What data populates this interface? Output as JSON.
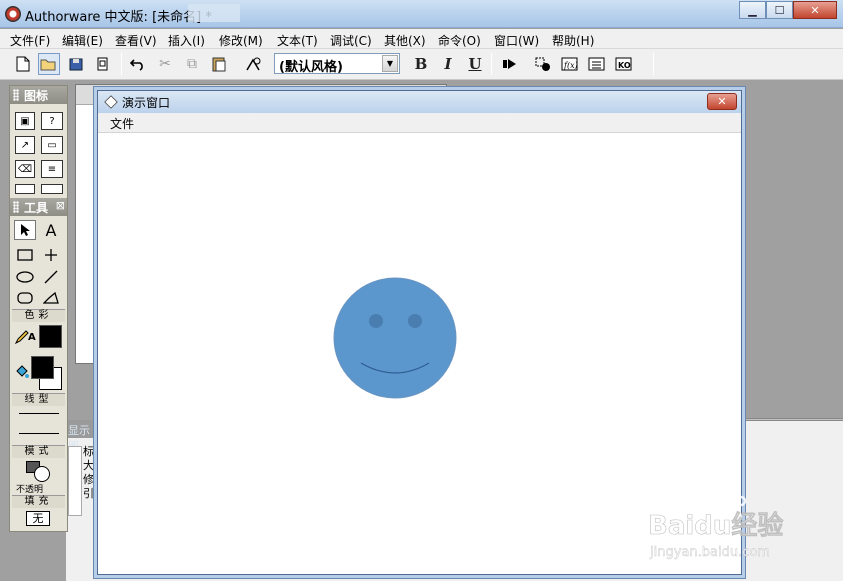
{
  "window": {
    "title": "Authorware 中文版: [未命名] *",
    "minimize_glyph": "▁",
    "maximize_glyph": "☐",
    "close_glyph": "✕"
  },
  "menubar": {
    "items": [
      "文件(F)",
      "编辑(E)",
      "查看(V)",
      "插入(I)",
      "修改(M)",
      "文本(T)",
      "调试(C)",
      "其他(X)",
      "命令(O)",
      "窗口(W)",
      "帮助(H)"
    ]
  },
  "toolbar": {
    "style_select": "(默认风格)",
    "bold": "B",
    "italic": "I",
    "underline": "U"
  },
  "icon_palette": {
    "title": "图标"
  },
  "tools_palette": {
    "title": "工具",
    "text_tool_glyph": "A",
    "color_section": "色彩",
    "line_section": "线型",
    "mode_section": "模式",
    "mode_value": "不透明",
    "fill_section": "填充",
    "fill_value": "无",
    "pencil_label": "A"
  },
  "presentation_window": {
    "title": "演示窗口",
    "menu_file": "文件",
    "close_glyph": "✕",
    "face_color": "#5b96cc",
    "eye_color": "#4a7eb0"
  },
  "lower_panel": {
    "strip_text": "显示图",
    "lines": [
      "标",
      "大",
      "修",
      "引"
    ]
  },
  "watermark": {
    "brand": "Baidu经验",
    "url": "jingyan.baidu.com"
  }
}
